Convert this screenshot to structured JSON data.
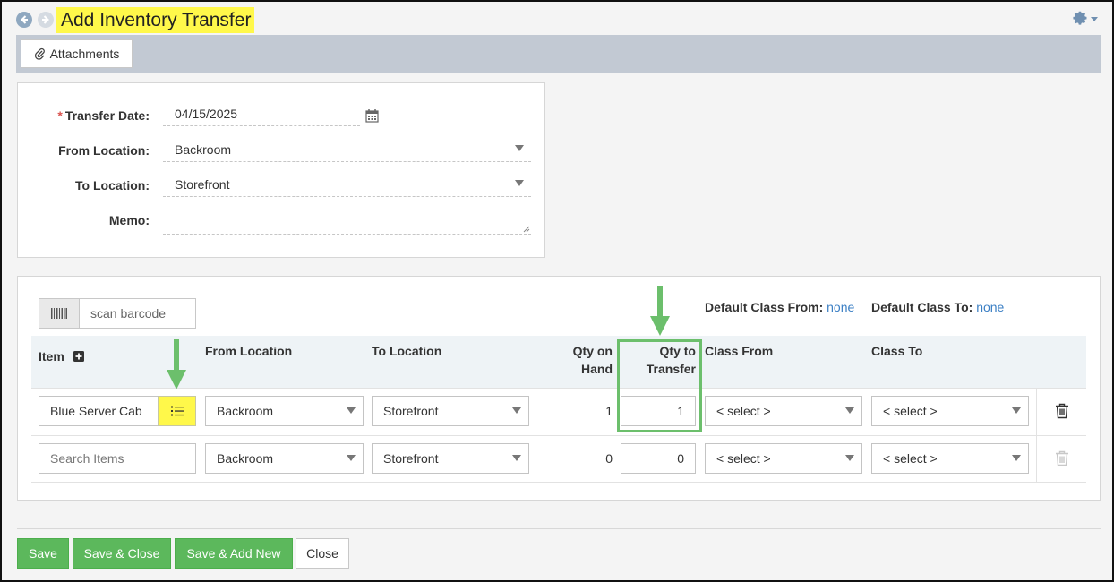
{
  "header": {
    "title": "Add Inventory Transfer",
    "back_icon": "arrow-left-icon",
    "forward_icon": "arrow-right-icon",
    "settings_icon": "gear-icon"
  },
  "toolbar": {
    "attachments_label": "Attachments",
    "attachments_icon": "paperclip-icon"
  },
  "form": {
    "transfer_date": {
      "label": "Transfer Date:",
      "required_marker": "*",
      "value": "04/15/2025"
    },
    "from_location": {
      "label": "From Location:",
      "value": "Backroom"
    },
    "to_location": {
      "label": "To Location:",
      "value": "Storefront"
    },
    "memo": {
      "label": "Memo:",
      "value": ""
    }
  },
  "grid": {
    "scan_placeholder": "scan barcode",
    "default_class_from": {
      "label": "Default Class From:",
      "value": "none"
    },
    "default_class_to": {
      "label": "Default Class To:",
      "value": "none"
    },
    "columns": {
      "item": "Item",
      "from_location": "From Location",
      "to_location": "To Location",
      "qty_on_hand_1": "Qty on",
      "qty_on_hand_2": "Hand",
      "qty_transfer_1": "Qty to",
      "qty_transfer_2": "Transfer",
      "class_from": "Class From",
      "class_to": "Class To"
    },
    "rows": [
      {
        "item": "Blue Server Cab",
        "from_location": "Backroom",
        "to_location": "Storefront",
        "qty_on_hand": "1",
        "qty_to_transfer": "1",
        "class_from": "< select >",
        "class_to": "< select >"
      },
      {
        "item_placeholder": "Search Items",
        "from_location": "Backroom",
        "to_location": "Storefront",
        "qty_on_hand": "0",
        "qty_to_transfer": "0",
        "class_from": "< select >",
        "class_to": "< select >"
      }
    ]
  },
  "footer": {
    "save": "Save",
    "save_close": "Save & Close",
    "save_add_new": "Save & Add New",
    "close": "Close"
  },
  "colors": {
    "highlight": "#fff84a",
    "annotation_green": "#6cbf6c",
    "button_green": "#5cb85c",
    "link_blue": "#3b7fc4"
  }
}
